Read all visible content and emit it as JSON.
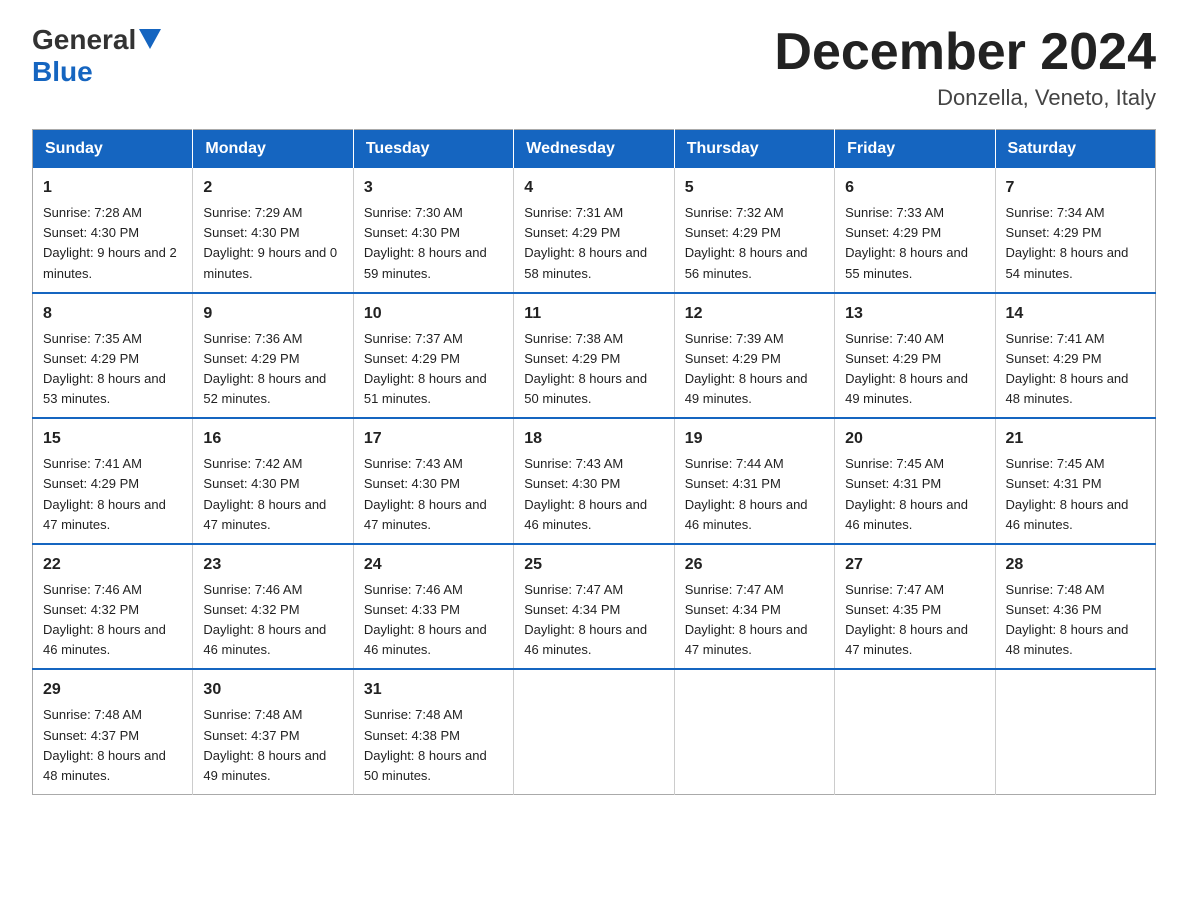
{
  "header": {
    "logo_general": "General",
    "logo_blue": "Blue",
    "month_title": "December 2024",
    "location": "Donzella, Veneto, Italy"
  },
  "weekdays": [
    "Sunday",
    "Monday",
    "Tuesday",
    "Wednesday",
    "Thursday",
    "Friday",
    "Saturday"
  ],
  "weeks": [
    [
      {
        "day": "1",
        "sunrise": "7:28 AM",
        "sunset": "4:30 PM",
        "daylight": "9 hours and 2 minutes."
      },
      {
        "day": "2",
        "sunrise": "7:29 AM",
        "sunset": "4:30 PM",
        "daylight": "9 hours and 0 minutes."
      },
      {
        "day": "3",
        "sunrise": "7:30 AM",
        "sunset": "4:30 PM",
        "daylight": "8 hours and 59 minutes."
      },
      {
        "day": "4",
        "sunrise": "7:31 AM",
        "sunset": "4:29 PM",
        "daylight": "8 hours and 58 minutes."
      },
      {
        "day": "5",
        "sunrise": "7:32 AM",
        "sunset": "4:29 PM",
        "daylight": "8 hours and 56 minutes."
      },
      {
        "day": "6",
        "sunrise": "7:33 AM",
        "sunset": "4:29 PM",
        "daylight": "8 hours and 55 minutes."
      },
      {
        "day": "7",
        "sunrise": "7:34 AM",
        "sunset": "4:29 PM",
        "daylight": "8 hours and 54 minutes."
      }
    ],
    [
      {
        "day": "8",
        "sunrise": "7:35 AM",
        "sunset": "4:29 PM",
        "daylight": "8 hours and 53 minutes."
      },
      {
        "day": "9",
        "sunrise": "7:36 AM",
        "sunset": "4:29 PM",
        "daylight": "8 hours and 52 minutes."
      },
      {
        "day": "10",
        "sunrise": "7:37 AM",
        "sunset": "4:29 PM",
        "daylight": "8 hours and 51 minutes."
      },
      {
        "day": "11",
        "sunrise": "7:38 AM",
        "sunset": "4:29 PM",
        "daylight": "8 hours and 50 minutes."
      },
      {
        "day": "12",
        "sunrise": "7:39 AM",
        "sunset": "4:29 PM",
        "daylight": "8 hours and 49 minutes."
      },
      {
        "day": "13",
        "sunrise": "7:40 AM",
        "sunset": "4:29 PM",
        "daylight": "8 hours and 49 minutes."
      },
      {
        "day": "14",
        "sunrise": "7:41 AM",
        "sunset": "4:29 PM",
        "daylight": "8 hours and 48 minutes."
      }
    ],
    [
      {
        "day": "15",
        "sunrise": "7:41 AM",
        "sunset": "4:29 PM",
        "daylight": "8 hours and 47 minutes."
      },
      {
        "day": "16",
        "sunrise": "7:42 AM",
        "sunset": "4:30 PM",
        "daylight": "8 hours and 47 minutes."
      },
      {
        "day": "17",
        "sunrise": "7:43 AM",
        "sunset": "4:30 PM",
        "daylight": "8 hours and 47 minutes."
      },
      {
        "day": "18",
        "sunrise": "7:43 AM",
        "sunset": "4:30 PM",
        "daylight": "8 hours and 46 minutes."
      },
      {
        "day": "19",
        "sunrise": "7:44 AM",
        "sunset": "4:31 PM",
        "daylight": "8 hours and 46 minutes."
      },
      {
        "day": "20",
        "sunrise": "7:45 AM",
        "sunset": "4:31 PM",
        "daylight": "8 hours and 46 minutes."
      },
      {
        "day": "21",
        "sunrise": "7:45 AM",
        "sunset": "4:31 PM",
        "daylight": "8 hours and 46 minutes."
      }
    ],
    [
      {
        "day": "22",
        "sunrise": "7:46 AM",
        "sunset": "4:32 PM",
        "daylight": "8 hours and 46 minutes."
      },
      {
        "day": "23",
        "sunrise": "7:46 AM",
        "sunset": "4:32 PM",
        "daylight": "8 hours and 46 minutes."
      },
      {
        "day": "24",
        "sunrise": "7:46 AM",
        "sunset": "4:33 PM",
        "daylight": "8 hours and 46 minutes."
      },
      {
        "day": "25",
        "sunrise": "7:47 AM",
        "sunset": "4:34 PM",
        "daylight": "8 hours and 46 minutes."
      },
      {
        "day": "26",
        "sunrise": "7:47 AM",
        "sunset": "4:34 PM",
        "daylight": "8 hours and 47 minutes."
      },
      {
        "day": "27",
        "sunrise": "7:47 AM",
        "sunset": "4:35 PM",
        "daylight": "8 hours and 47 minutes."
      },
      {
        "day": "28",
        "sunrise": "7:48 AM",
        "sunset": "4:36 PM",
        "daylight": "8 hours and 48 minutes."
      }
    ],
    [
      {
        "day": "29",
        "sunrise": "7:48 AM",
        "sunset": "4:37 PM",
        "daylight": "8 hours and 48 minutes."
      },
      {
        "day": "30",
        "sunrise": "7:48 AM",
        "sunset": "4:37 PM",
        "daylight": "8 hours and 49 minutes."
      },
      {
        "day": "31",
        "sunrise": "7:48 AM",
        "sunset": "4:38 PM",
        "daylight": "8 hours and 50 minutes."
      },
      null,
      null,
      null,
      null
    ]
  ],
  "labels": {
    "sunrise": "Sunrise: ",
    "sunset": "Sunset: ",
    "daylight": "Daylight: "
  }
}
